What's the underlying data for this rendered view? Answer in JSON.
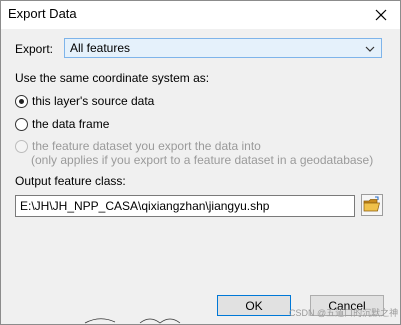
{
  "window": {
    "title": "Export Data"
  },
  "export": {
    "label": "Export:",
    "selected": "All features"
  },
  "coordinate": {
    "label": "Use the same coordinate system as:",
    "options": [
      {
        "label": "this layer's source data",
        "checked": true,
        "disabled": false
      },
      {
        "label": "the data frame",
        "checked": false,
        "disabled": false
      },
      {
        "label": "the feature dataset you export the data into",
        "checked": false,
        "disabled": true
      }
    ],
    "note": "(only applies if you export to a feature dataset in a geodatabase)"
  },
  "output": {
    "label": "Output feature class:",
    "value": "E:\\JH\\JH_NPP_CASA\\qixiangzhan\\jiangyu.shp"
  },
  "buttons": {
    "ok": "OK",
    "cancel": "Cancel"
  },
  "watermark": "CSDN @五道口的沉默之神",
  "icons": {
    "close": "close-icon",
    "dropdown": "chevron-down-icon",
    "browse": "open-folder-icon"
  },
  "colors": {
    "accent": "#0078d7",
    "folder": "#e8b03a"
  }
}
